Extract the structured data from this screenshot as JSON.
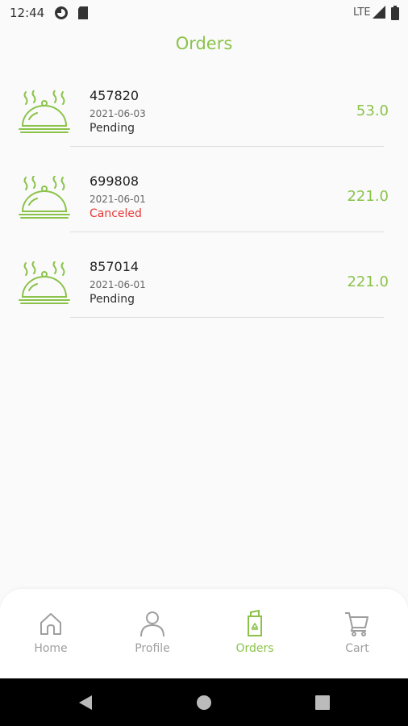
{
  "status_bar": {
    "time": "12:44",
    "network": "LTE",
    "icons": [
      "circle-status-icon",
      "sd-card-icon",
      "signal-icon",
      "battery-icon"
    ]
  },
  "header": {
    "title": "Orders"
  },
  "orders": [
    {
      "id": "457820",
      "date": "2021-06-03",
      "status": "Pending",
      "status_color": "#333333",
      "total": "53.0"
    },
    {
      "id": "699808",
      "date": "2021-06-01",
      "status": "Canceled",
      "status_color": "#e53935",
      "total": "221.0"
    },
    {
      "id": "857014",
      "date": "2021-06-01",
      "status": "Pending",
      "status_color": "#333333",
      "total": "221.0"
    }
  ],
  "nav": {
    "items": [
      {
        "label": "Home",
        "icon": "home-icon"
      },
      {
        "label": "Profile",
        "icon": "user-icon"
      },
      {
        "label": "Orders",
        "icon": "orders-icon"
      },
      {
        "label": "Cart",
        "icon": "cart-icon"
      }
    ],
    "active": "Orders"
  },
  "colors": {
    "accent": "#8bc34a",
    "inactive": "#9e9e9e",
    "canceled": "#e53935"
  }
}
